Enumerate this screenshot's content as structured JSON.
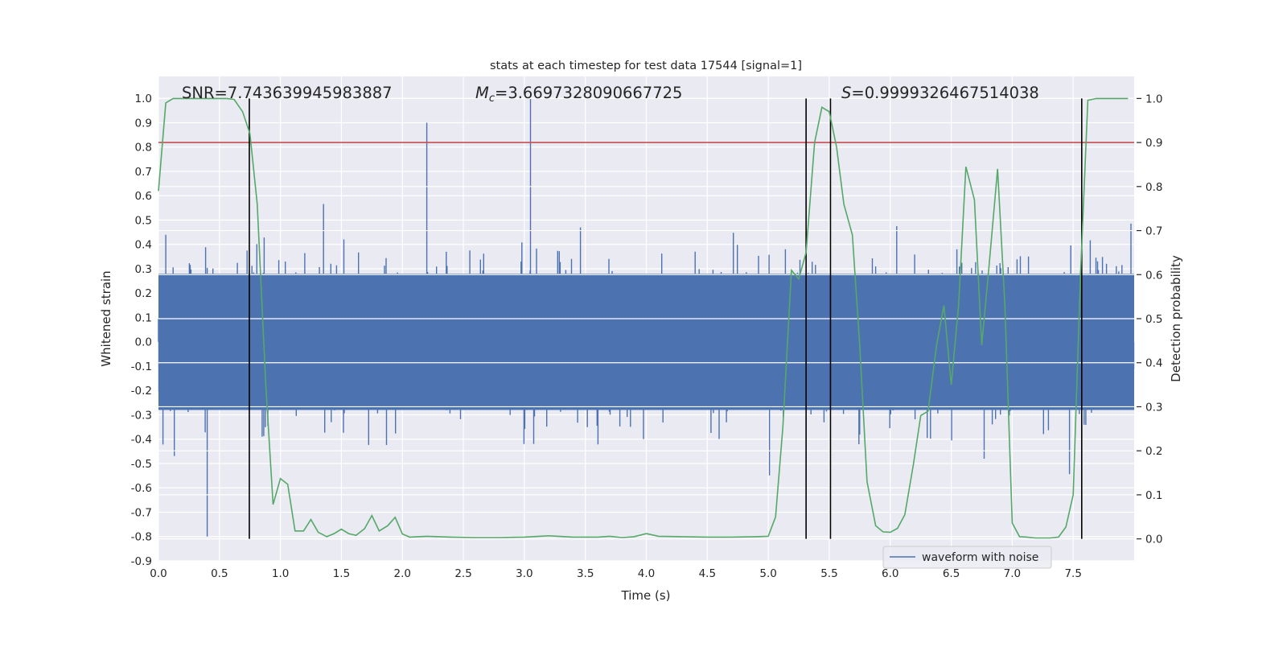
{
  "chart_data": {
    "type": "line",
    "title": "stats at each timestep for test data 17544 [signal=1]",
    "xlabel": "Time (s)",
    "ylabel": "Whitened strain",
    "y2label": "Detection probability",
    "xlim": [
      0,
      8
    ],
    "ylim": [
      -0.9,
      1.09
    ],
    "y2lim": [
      -0.05,
      1.05
    ],
    "grid": true,
    "xticks": [
      "0.0",
      "0.5",
      "1.0",
      "1.5",
      "2.0",
      "2.5",
      "3.0",
      "3.5",
      "4.0",
      "4.5",
      "5.0",
      "5.5",
      "6.0",
      "6.5",
      "7.0",
      "7.5"
    ],
    "yticks": [
      "1.0",
      "0.9",
      "0.8",
      "0.7",
      "0.6",
      "0.5",
      "0.4",
      "0.3",
      "0.2",
      "0.1",
      "0.0",
      "-0.1",
      "-0.2",
      "-0.3",
      "-0.4",
      "-0.5",
      "-0.6",
      "-0.7",
      "-0.8",
      "-0.9"
    ],
    "y2ticks": [
      "1.0",
      "0.9",
      "0.8",
      "0.7",
      "0.6",
      "0.5",
      "0.4",
      "0.3",
      "0.2",
      "0.1",
      "0.0"
    ],
    "annotations": {
      "snr": "SNR=7.743639945983887",
      "mc_prefix": "M",
      "mc_sub": "c",
      "mc_value": "=3.6697328090667725",
      "s_prefix": "S",
      "s_value": "=0.9999326467514038"
    },
    "legend": {
      "placement": "lower-right",
      "entries": [
        "waveform with noise"
      ]
    },
    "waveform": {
      "name": "waveform with noise",
      "color": "#4c72b0",
      "axis": "left",
      "approx_range": [
        -0.8,
        1.0
      ],
      "peaks": [
        {
          "t": 3.05,
          "v": 1.0
        },
        {
          "t": 2.2,
          "v": 0.9
        },
        {
          "t": 0.4,
          "v": -0.8
        }
      ]
    },
    "detection_probability": {
      "color": "#55a868",
      "axis": "right",
      "t": [
        0.0,
        0.06,
        0.12,
        0.19,
        0.25,
        0.31,
        0.38,
        0.44,
        0.5,
        0.56,
        0.62,
        0.69,
        0.75,
        0.81,
        0.88,
        0.94,
        1.0,
        1.06,
        1.12,
        1.19,
        1.25,
        1.31,
        1.38,
        1.44,
        1.5,
        1.56,
        1.62,
        1.69,
        1.75,
        1.81,
        1.88,
        1.94,
        2.0,
        2.06,
        2.2,
        2.4,
        2.6,
        2.8,
        3.0,
        3.2,
        3.4,
        3.6,
        3.7,
        3.8,
        3.9,
        4.0,
        4.1,
        4.3,
        4.5,
        4.7,
        4.9,
        5.0,
        5.06,
        5.12,
        5.19,
        5.25,
        5.31,
        5.38,
        5.44,
        5.5,
        5.56,
        5.62,
        5.69,
        5.75,
        5.81,
        5.88,
        5.94,
        6.0,
        6.06,
        6.12,
        6.19,
        6.25,
        6.31,
        6.38,
        6.44,
        6.5,
        6.56,
        6.62,
        6.69,
        6.75,
        6.81,
        6.88,
        6.94,
        7.0,
        7.06,
        7.12,
        7.19,
        7.25,
        7.31,
        7.38,
        7.44,
        7.5,
        7.56,
        7.62,
        7.69,
        7.75,
        7.81,
        7.88,
        7.95
      ],
      "p": [
        0.79,
        0.99,
        1.0,
        1.0,
        1.0,
        1.0,
        1.0,
        1.0,
        1.0,
        1.0,
        0.998,
        0.97,
        0.92,
        0.76,
        0.35,
        0.078,
        0.137,
        0.124,
        0.018,
        0.018,
        0.044,
        0.015,
        0.005,
        0.012,
        0.022,
        0.012,
        0.008,
        0.023,
        0.053,
        0.018,
        0.03,
        0.049,
        0.011,
        0.004,
        0.006,
        0.004,
        0.003,
        0.003,
        0.004,
        0.007,
        0.004,
        0.004,
        0.006,
        0.003,
        0.005,
        0.012,
        0.006,
        0.005,
        0.004,
        0.004,
        0.005,
        0.006,
        0.05,
        0.255,
        0.61,
        0.59,
        0.65,
        0.9,
        0.98,
        0.97,
        0.89,
        0.76,
        0.69,
        0.44,
        0.13,
        0.03,
        0.016,
        0.015,
        0.024,
        0.055,
        0.17,
        0.28,
        0.29,
        0.44,
        0.53,
        0.35,
        0.53,
        0.845,
        0.77,
        0.44,
        0.62,
        0.84,
        0.53,
        0.036,
        0.005,
        0.004,
        0.002,
        0.002,
        0.002,
        0.004,
        0.027,
        0.1,
        0.6,
        0.996,
        1.0,
        1.0,
        1.0,
        1.0,
        1.0
      ]
    },
    "threshold": {
      "color": "#c44e52",
      "axis": "right",
      "value": 0.9
    },
    "vertical_markers": {
      "color": "#000000",
      "t": [
        0.745,
        5.31,
        5.51,
        7.57
      ],
      "range": [
        0,
        1
      ]
    }
  }
}
